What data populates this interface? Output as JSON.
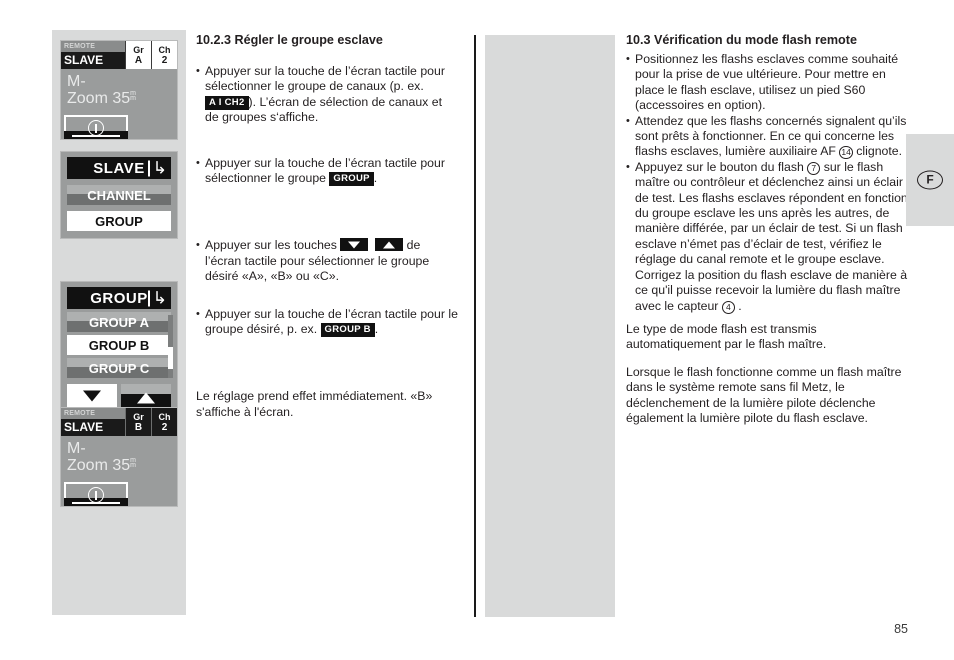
{
  "page": {
    "number": "85",
    "language_marker": "F"
  },
  "lcd_panels": [
    {
      "id": "remote-slave-group-a",
      "type": "status",
      "mode_small": "REMOTE",
      "mode_large": "SLAVE",
      "cells": [
        {
          "key": "Gr",
          "value": "A"
        },
        {
          "key": "Ch",
          "value": "2"
        }
      ],
      "body_line1": "M-",
      "body_line2": "Zoom 35",
      "body_unit_top": "m",
      "body_unit_bottom": "m",
      "footer_icon": "info-icon"
    },
    {
      "id": "slave-menu",
      "type": "menu",
      "header": "SLAVE",
      "back_icon": "back-arrow-icon",
      "rows": [
        {
          "label": "CHANNEL",
          "selected": false
        },
        {
          "label": "GROUP",
          "selected": true
        }
      ]
    },
    {
      "id": "group-menu",
      "type": "menu-list",
      "header": "GROUP",
      "back_icon": "back-arrow-icon",
      "rows": [
        {
          "label": "GROUP A",
          "selected": false
        },
        {
          "label": "GROUP B",
          "selected": true
        },
        {
          "label": "GROUP C",
          "selected": false
        }
      ],
      "nav": [
        {
          "icon": "triangle-down-icon",
          "style": "white"
        },
        {
          "icon": "triangle-up-icon",
          "style": "dark"
        }
      ]
    },
    {
      "id": "remote-slave-group-b",
      "type": "status",
      "mode_small": "REMOTE",
      "mode_large": "SLAVE",
      "cells": [
        {
          "key": "Gr",
          "value": "B"
        },
        {
          "key": "Ch",
          "value": "2"
        }
      ],
      "body_line1": "M-",
      "body_line2": "Zoom 35",
      "body_unit_top": "m",
      "body_unit_bottom": "m",
      "footer_icon": "info-icon"
    }
  ],
  "left_column": {
    "heading": "10.2.3 Régler le groupe esclave",
    "bullet1_part1": "Appuyer sur la touche de l’écran tactile pour sélectionner le groupe de canaux (p. ex. ",
    "bullet1_badge": "A I CH2",
    "bullet1_part2": "). L’écran de sélection de canaux et de groupes s‘affiche.",
    "bullet2_part1": "Appuyer sur la touche de l’écran tactile pour sélectionner le groupe ",
    "bullet2_badge": "GROUP",
    "bullet2_part2": ".",
    "bullet3_part1": "Appuyer sur les touches ",
    "bullet3_part2": " de l’écran tactile pour sélectionner le groupe désiré «A», «B» ou «C».",
    "bullet4_part1": "Appuyer sur la touche de l’écran tactile pour le groupe désiré, p. ex. ",
    "bullet4_badge": "GROUP B",
    "bullet4_part2": ".",
    "closing": "Le réglage prend effet immédiatement. «B» s'affiche à l'écran."
  },
  "right_column": {
    "heading": "10.3 Vérification du mode flash remote",
    "bullet1": "Positionnez les flashs esclaves comme souhaité pour la prise de vue ultérieure. Pour mettre en place le flash esclave, utilisez un pied S60 (accessoires en option).",
    "bullet2_part1": "Attendez que les flashs concernés signalent qu’ils sont prêts à fonctionner. En ce qui concerne les flashs esclaves, lumière auxiliaire AF ",
    "bullet2_ref": "14",
    "bullet2_part2": " clignote.",
    "bullet3_part1": "Appuyez sur le bouton du flash ",
    "bullet3_ref1": "7",
    "bullet3_part2": " sur le flash maître ou contrôleur et déclenchez ainsi un éclair de test. Les flashs esclaves répondent en fonction du groupe esclave les uns après les autres, de manière différée, par un éclair de test. Si un flash esclave n’émet pas d’éclair de test, vérifiez le réglage du canal remote et le groupe esclave. Corrigez la position du flash esclave de manière à ce qu'il puisse recevoir la lumière du flash maître avec le capteur ",
    "bullet3_ref2": "4",
    "bullet3_part3": " .",
    "para1": "Le type de mode flash est transmis automatiquement par le flash maître.",
    "para2": "Lorsque le flash fonctionne comme un flash maître dans le système remote sans fil Metz, le déclenchement de la lumière pilote déclenche également la lumière pilote du flash esclave."
  }
}
